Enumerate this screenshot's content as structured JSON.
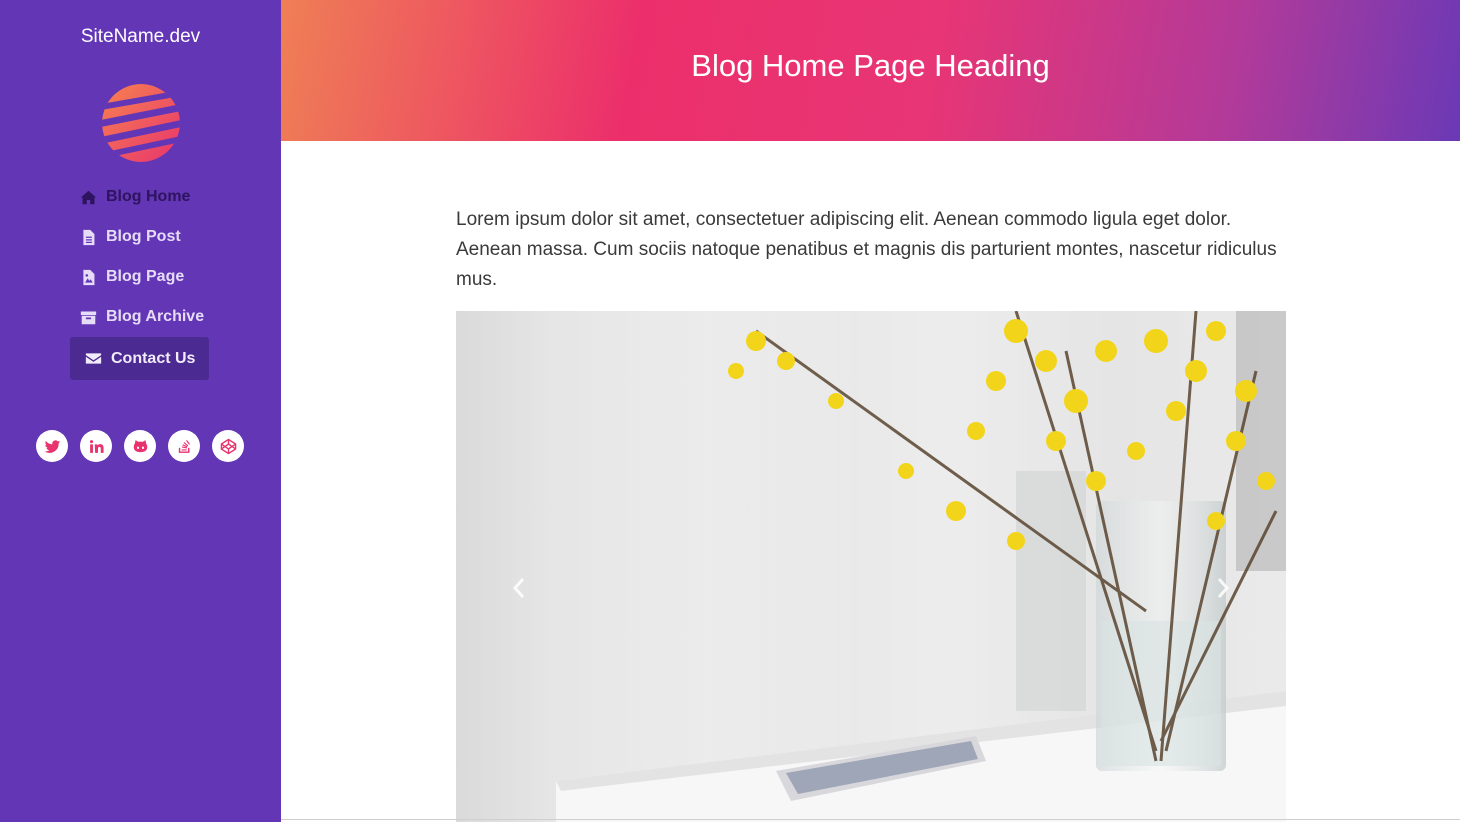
{
  "sidebar": {
    "site_name": "SiteName.dev",
    "logo_icon": "striped-globe-logo",
    "nav_items": [
      {
        "label": "Blog Home",
        "icon": "home-icon",
        "active": true
      },
      {
        "label": "Blog Post",
        "icon": "file-text-icon",
        "active": false
      },
      {
        "label": "Blog Page",
        "icon": "file-image-icon",
        "active": false
      },
      {
        "label": "Blog Archive",
        "icon": "archive-icon",
        "active": false
      },
      {
        "label": "Contact Us",
        "icon": "envelope-icon",
        "active": false,
        "highlighted": true
      }
    ],
    "social_links": [
      {
        "icon": "twitter-icon"
      },
      {
        "icon": "linkedin-icon"
      },
      {
        "icon": "github-icon"
      },
      {
        "icon": "stack-overflow-icon"
      },
      {
        "icon": "codepen-icon"
      }
    ]
  },
  "header": {
    "title": "Blog Home Page Heading"
  },
  "main": {
    "intro": "Lorem ipsum dolor sit amet, consectetuer adipiscing elit. Aenean commodo ligula eget dolor. Aenean massa. Cum sociis natoque penatibus et magnis dis parturient montes, nascetur ridiculus mus.",
    "carousel": {
      "prev_icon": "chevron-left-icon",
      "next_icon": "chevron-right-icon"
    }
  },
  "colors": {
    "sidebar_bg": "#6336b6",
    "accent": "#ec2f6b",
    "contact_bg": "#4b2a92"
  }
}
